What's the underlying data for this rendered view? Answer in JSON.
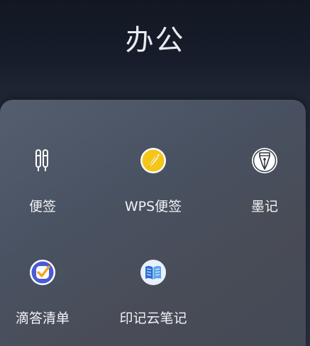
{
  "folder": {
    "title": "办公"
  },
  "apps": [
    {
      "label": "便签",
      "icon": "notes-pens-icon"
    },
    {
      "label": "WPS便签",
      "icon": "wps-notes-icon"
    },
    {
      "label": "墨记",
      "icon": "fountain-pen-icon"
    },
    {
      "label": "滴答清单",
      "icon": "checklist-icon"
    },
    {
      "label": "印记云笔记",
      "icon": "open-book-icon"
    }
  ],
  "colors": {
    "wps_yellow": "#f5c518",
    "check_orange": "#f2a51c",
    "book_blue": "#2b6fd6"
  }
}
